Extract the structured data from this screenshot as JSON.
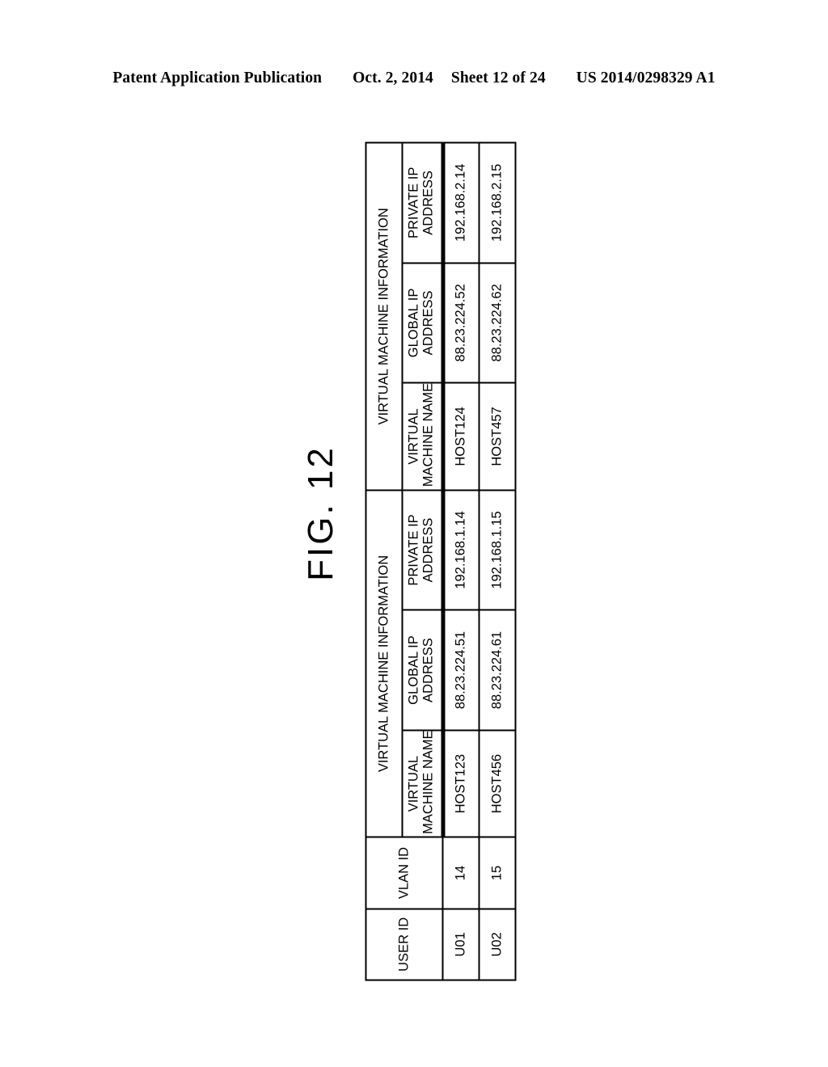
{
  "header": {
    "publication": "Patent Application Publication",
    "date": "Oct. 2, 2014",
    "sheet": "Sheet 12 of 24",
    "doc_number": "US 2014/0298329 A1"
  },
  "figure": {
    "label": "FIG. 12"
  },
  "table": {
    "columns": {
      "user_id": "USER ID",
      "vlan_id": "VLAN ID",
      "vm_name": "VIRTUAL\nMACHINE NAME",
      "vm_name_line1": "VIRTUAL",
      "vm_name_line2": "MACHINE NAME",
      "global_ip": "GLOBAL IP\nADDRESS",
      "global_ip_line1": "GLOBAL IP",
      "global_ip_line2": "ADDRESS",
      "private_ip": "PRIVATE IP\nADDRESS",
      "private_ip_line1": "PRIVATE IP",
      "private_ip_line2": "ADDRESS"
    },
    "group_headers": {
      "vm_info_1": "VIRTUAL MACHINE INFORMATION",
      "vm_info_2": "VIRTUAL MACHINE INFORMATION"
    },
    "rows": [
      {
        "user_id": "U01",
        "vlan_id": "14",
        "vm1_name": "HOST123",
        "vm1_global_ip": "88.23.224.51",
        "vm1_private_ip": "192.168.1.14",
        "vm2_name": "HOST124",
        "vm2_global_ip": "88.23.224.52",
        "vm2_private_ip": "192.168.2.14"
      },
      {
        "user_id": "U02",
        "vlan_id": "15",
        "vm1_name": "HOST456",
        "vm1_global_ip": "88.23.224.61",
        "vm1_private_ip": "192.168.1.15",
        "vm2_name": "HOST457",
        "vm2_global_ip": "88.23.224.62",
        "vm2_private_ip": "192.168.2.15"
      }
    ]
  }
}
